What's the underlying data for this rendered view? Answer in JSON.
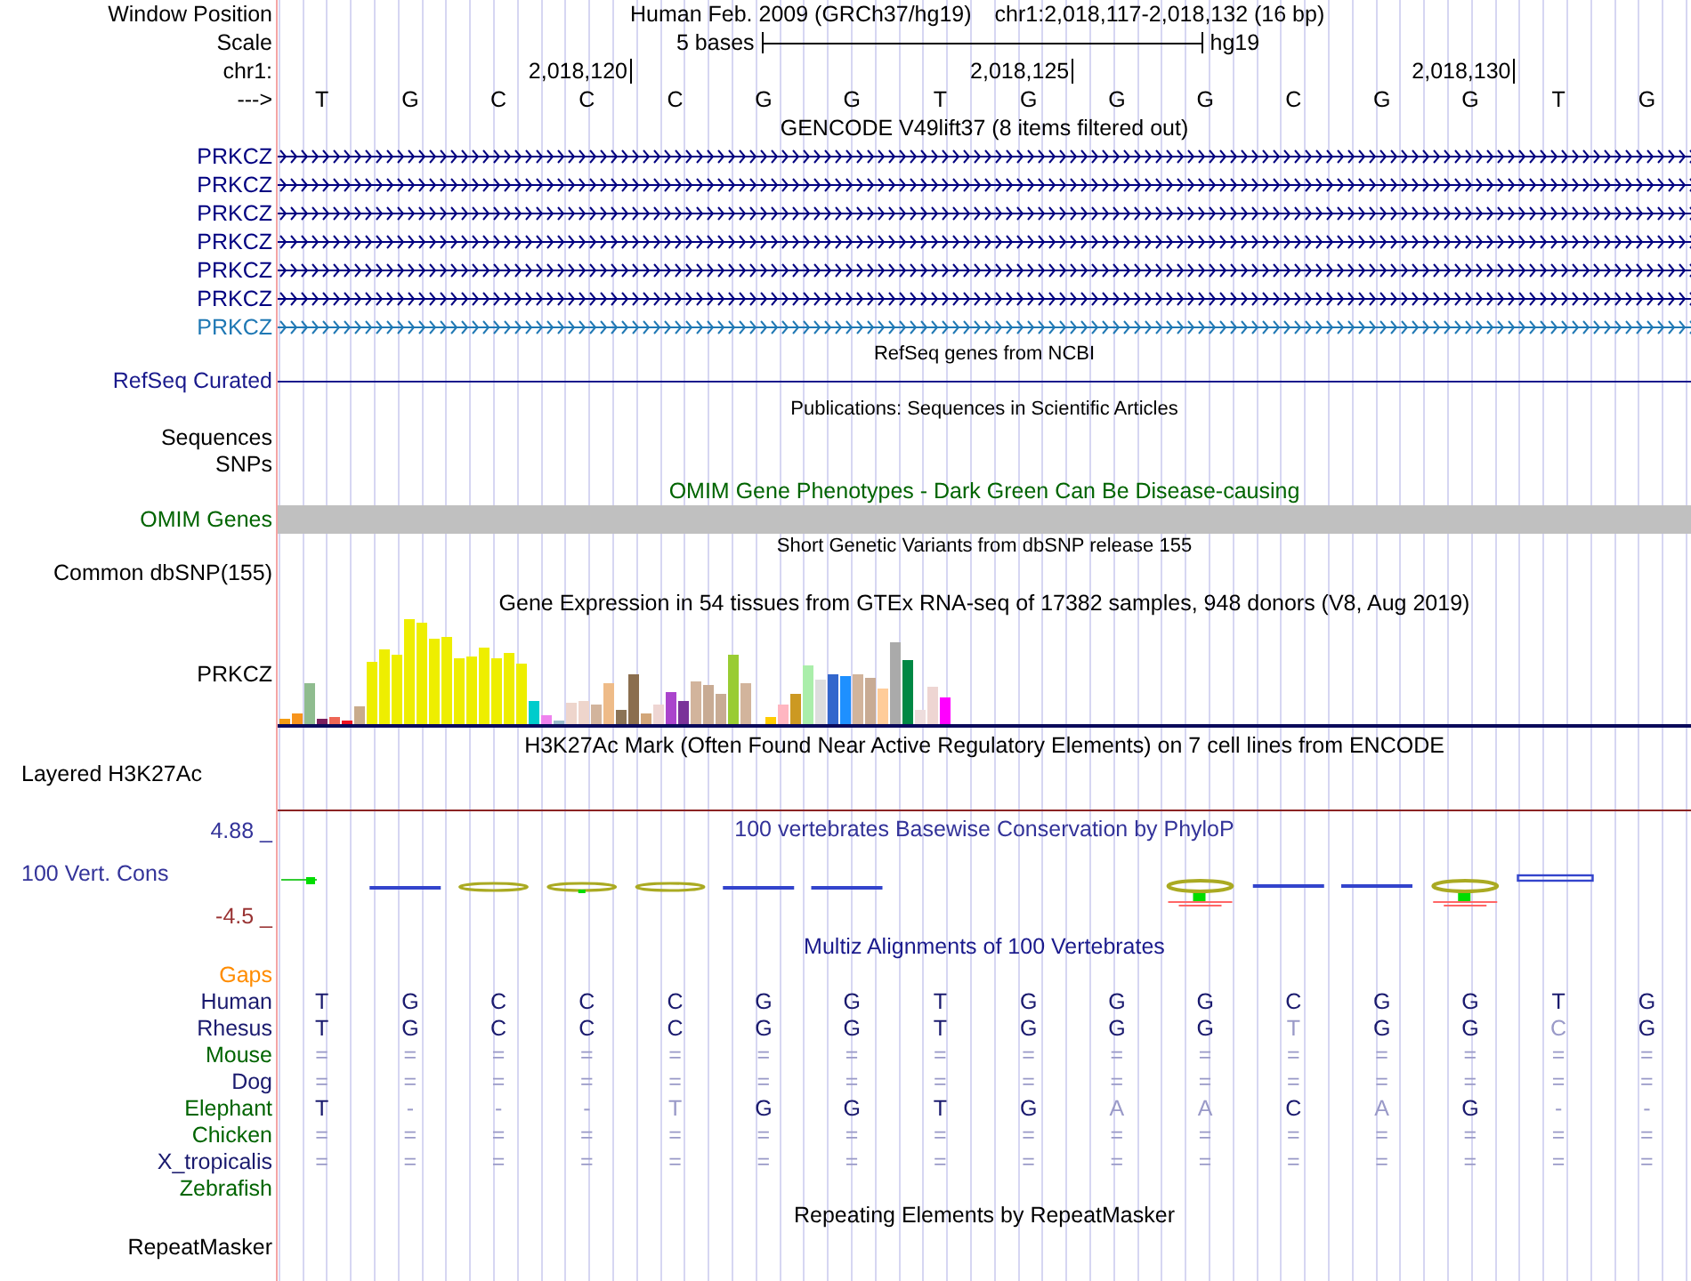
{
  "header": {
    "window_position_label": "Window Position",
    "assembly": "Human Feb. 2009 (GRCh37/hg19)",
    "position": "chr1:2,018,117-2,018,132 (16 bp)",
    "scale_label": "Scale",
    "scale_text": "5 bases",
    "scale_db": "hg19",
    "chrom_label": "chr1:",
    "ruler_ticks": [
      "2,018,120",
      "2,018,125",
      "2,018,130"
    ],
    "strand_label": "--->",
    "bases": [
      "T",
      "G",
      "C",
      "C",
      "C",
      "G",
      "G",
      "T",
      "G",
      "G",
      "G",
      "C",
      "G",
      "G",
      "T",
      "G"
    ]
  },
  "tracks": [
    {
      "kind": "gencode",
      "title": "GENCODE V49lift37 (8 items filtered out)",
      "genes": [
        {
          "name": "PRKCZ",
          "color": "#000080"
        },
        {
          "name": "PRKCZ",
          "color": "#000080"
        },
        {
          "name": "PRKCZ",
          "color": "#000080"
        },
        {
          "name": "PRKCZ",
          "color": "#000080"
        },
        {
          "name": "PRKCZ",
          "color": "#000080"
        },
        {
          "name": "PRKCZ",
          "color": "#000080"
        },
        {
          "name": "PRKCZ",
          "color": "#1f78b4"
        }
      ]
    },
    {
      "kind": "refseq",
      "title": "RefSeq genes from NCBI",
      "labels": [
        {
          "text": "RefSeq Curated",
          "color": "#1a1a8c"
        }
      ]
    },
    {
      "kind": "publications",
      "title": "Publications: Sequences in Scientific Articles",
      "labels": [
        {
          "text": "Sequences",
          "color": "#000000"
        },
        {
          "text": "SNPs",
          "color": "#000000"
        }
      ]
    },
    {
      "kind": "omim",
      "title": "OMIM Gene Phenotypes - Dark Green Can Be Disease-causing",
      "labels": [
        {
          "text": "OMIM Genes",
          "color": "#006400"
        }
      ]
    },
    {
      "kind": "dbsnp",
      "title": "Short Genetic Variants from dbSNP release 155",
      "labels": [
        {
          "text": "Common dbSNP(155)",
          "color": "#000000"
        }
      ]
    },
    {
      "kind": "gtex",
      "title": "Gene Expression in 54 tissues from GTEx RNA-seq of 17382 samples, 948 donors (V8, Aug 2019)",
      "labels": [
        {
          "text": "PRKCZ",
          "color": "#000000"
        }
      ]
    },
    {
      "kind": "h3k27ac",
      "title": "H3K27Ac Mark (Often Found Near Active Regulatory Elements) on 7 cell lines from ENCODE",
      "labels": [
        {
          "text": "Layered H3K27Ac",
          "color": "#000000"
        }
      ]
    },
    {
      "kind": "phylop",
      "title": "100 vertebrates Basewise Conservation by PhyloP",
      "labels": [
        {
          "text": "4.88 _",
          "color": "#333399"
        },
        {
          "text": "100 Vert. Cons",
          "color": "#333399"
        },
        {
          "text": "-4.5 _",
          "color": "#993333"
        }
      ]
    },
    {
      "kind": "multiz",
      "title": "Multiz Alignments of 100 Vertebrates",
      "species": [
        {
          "name": "Gaps",
          "color": "#ff8c00"
        },
        {
          "name": "Human",
          "color": "#1a1a6e",
          "bases": [
            {
              "b": "T",
              "faded": false
            },
            {
              "b": "G",
              "faded": false
            },
            {
              "b": "C",
              "faded": false
            },
            {
              "b": "C",
              "faded": false
            },
            {
              "b": "C",
              "faded": false
            },
            {
              "b": "G",
              "faded": false
            },
            {
              "b": "G",
              "faded": false
            },
            {
              "b": "T",
              "faded": false
            },
            {
              "b": "G",
              "faded": false
            },
            {
              "b": "G",
              "faded": false
            },
            {
              "b": "G",
              "faded": false
            },
            {
              "b": "C",
              "faded": false
            },
            {
              "b": "G",
              "faded": false
            },
            {
              "b": "G",
              "faded": false
            },
            {
              "b": "T",
              "faded": false
            },
            {
              "b": "G",
              "faded": false
            }
          ]
        },
        {
          "name": "Rhesus",
          "color": "#1a1a6e",
          "bases": [
            {
              "b": "T",
              "faded": false
            },
            {
              "b": "G",
              "faded": false
            },
            {
              "b": "C",
              "faded": false
            },
            {
              "b": "C",
              "faded": false
            },
            {
              "b": "C",
              "faded": false
            },
            {
              "b": "G",
              "faded": false
            },
            {
              "b": "G",
              "faded": false
            },
            {
              "b": "T",
              "faded": false
            },
            {
              "b": "G",
              "faded": false
            },
            {
              "b": "G",
              "faded": false
            },
            {
              "b": "G",
              "faded": false
            },
            {
              "b": "T",
              "faded": true
            },
            {
              "b": "G",
              "faded": false
            },
            {
              "b": "G",
              "faded": false
            },
            {
              "b": "C",
              "faded": true
            },
            {
              "b": "G",
              "faded": false
            }
          ]
        },
        {
          "name": "Mouse",
          "color": "#006400",
          "bases": [
            {
              "b": "=",
              "faded": true
            },
            {
              "b": "=",
              "faded": true
            },
            {
              "b": "=",
              "faded": true
            },
            {
              "b": "=",
              "faded": true
            },
            {
              "b": "=",
              "faded": true
            },
            {
              "b": "=",
              "faded": true
            },
            {
              "b": "=",
              "faded": true
            },
            {
              "b": "=",
              "faded": true
            },
            {
              "b": "=",
              "faded": true
            },
            {
              "b": "=",
              "faded": true
            },
            {
              "b": "=",
              "faded": true
            },
            {
              "b": "=",
              "faded": true
            },
            {
              "b": "=",
              "faded": true
            },
            {
              "b": "=",
              "faded": true
            },
            {
              "b": "=",
              "faded": true
            },
            {
              "b": "=",
              "faded": true
            }
          ]
        },
        {
          "name": "Dog",
          "color": "#1a1a6e",
          "bases": [
            {
              "b": "=",
              "faded": true
            },
            {
              "b": "=",
              "faded": true
            },
            {
              "b": "=",
              "faded": true
            },
            {
              "b": "=",
              "faded": true
            },
            {
              "b": "=",
              "faded": true
            },
            {
              "b": "=",
              "faded": true
            },
            {
              "b": "=",
              "faded": true
            },
            {
              "b": "=",
              "faded": true
            },
            {
              "b": "=",
              "faded": true
            },
            {
              "b": "=",
              "faded": true
            },
            {
              "b": "=",
              "faded": true
            },
            {
              "b": "=",
              "faded": true
            },
            {
              "b": "=",
              "faded": true
            },
            {
              "b": "=",
              "faded": true
            },
            {
              "b": "=",
              "faded": true
            },
            {
              "b": "=",
              "faded": true
            }
          ]
        },
        {
          "name": "Elephant",
          "color": "#006400",
          "bases": [
            {
              "b": "T",
              "faded": false
            },
            {
              "b": "-",
              "faded": true
            },
            {
              "b": "-",
              "faded": true
            },
            {
              "b": "-",
              "faded": true
            },
            {
              "b": "T",
              "faded": true
            },
            {
              "b": "G",
              "faded": false
            },
            {
              "b": "G",
              "faded": false
            },
            {
              "b": "T",
              "faded": false
            },
            {
              "b": "G",
              "faded": false
            },
            {
              "b": "A",
              "faded": true
            },
            {
              "b": "A",
              "faded": true
            },
            {
              "b": "C",
              "faded": false
            },
            {
              "b": "A",
              "faded": true
            },
            {
              "b": "G",
              "faded": false
            },
            {
              "b": "-",
              "faded": true
            },
            {
              "b": "-",
              "faded": true
            }
          ]
        },
        {
          "name": "Chicken",
          "color": "#006400",
          "bases": [
            {
              "b": "=",
              "faded": true
            },
            {
              "b": "=",
              "faded": true
            },
            {
              "b": "=",
              "faded": true
            },
            {
              "b": "=",
              "faded": true
            },
            {
              "b": "=",
              "faded": true
            },
            {
              "b": "=",
              "faded": true
            },
            {
              "b": "=",
              "faded": true
            },
            {
              "b": "=",
              "faded": true
            },
            {
              "b": "=",
              "faded": true
            },
            {
              "b": "=",
              "faded": true
            },
            {
              "b": "=",
              "faded": true
            },
            {
              "b": "=",
              "faded": true
            },
            {
              "b": "=",
              "faded": true
            },
            {
              "b": "=",
              "faded": true
            },
            {
              "b": "=",
              "faded": true
            },
            {
              "b": "=",
              "faded": true
            }
          ]
        },
        {
          "name": "X_tropicalis",
          "color": "#1a1a6e",
          "bases": [
            {
              "b": "=",
              "faded": true
            },
            {
              "b": "=",
              "faded": true
            },
            {
              "b": "=",
              "faded": true
            },
            {
              "b": "=",
              "faded": true
            },
            {
              "b": "=",
              "faded": true
            },
            {
              "b": "=",
              "faded": true
            },
            {
              "b": "=",
              "faded": true
            },
            {
              "b": "=",
              "faded": true
            },
            {
              "b": "=",
              "faded": true
            },
            {
              "b": "=",
              "faded": true
            },
            {
              "b": "=",
              "faded": true
            },
            {
              "b": "=",
              "faded": true
            },
            {
              "b": "=",
              "faded": true
            },
            {
              "b": "=",
              "faded": true
            },
            {
              "b": "=",
              "faded": true
            },
            {
              "b": "=",
              "faded": true
            }
          ]
        },
        {
          "name": "Zebrafish",
          "color": "#006400"
        }
      ]
    },
    {
      "kind": "repeatmasker",
      "title": "Repeating Elements by RepeatMasker",
      "labels": [
        {
          "text": "RepeatMasker",
          "color": "#000000"
        }
      ]
    }
  ]
}
